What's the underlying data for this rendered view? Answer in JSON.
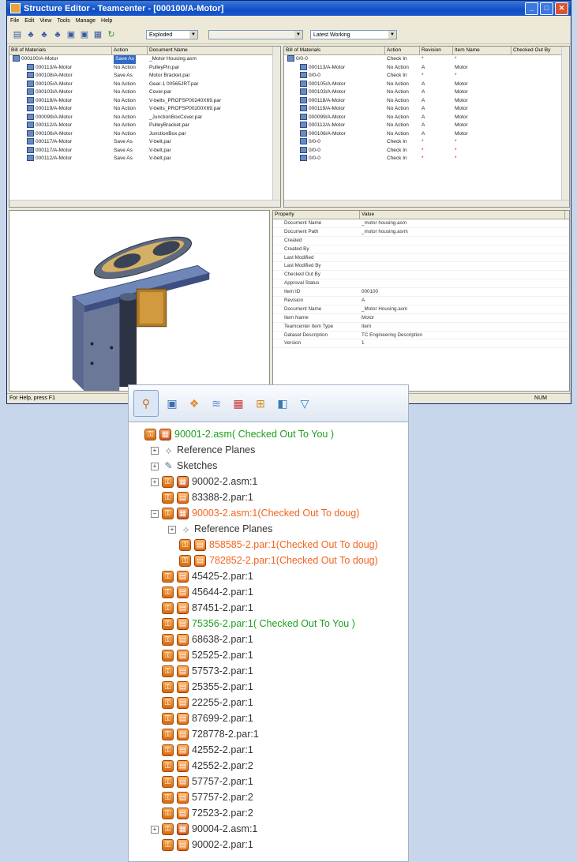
{
  "window": {
    "title": "Structure Editor - Teamcenter - [000100/A-Motor]",
    "menu": [
      "File",
      "Edit",
      "View",
      "Tools",
      "Manage",
      "Help"
    ],
    "toolbar": {
      "view_mode": "Exploded",
      "search_text": "",
      "revision_rule": "Latest Working"
    },
    "status_left": "For Help, press F1",
    "status_right": "NUM"
  },
  "left_bom": {
    "headers": [
      "Bill of Materials",
      "Action",
      "Document Name"
    ],
    "rows": [
      {
        "item": "000100/A-Motor",
        "action": "Save As",
        "doc": "_Motor Housing.asm"
      },
      {
        "item": "000113/A-Motor",
        "action": "No Action",
        "doc": "PulleyPin.par"
      },
      {
        "item": "000108/A-Motor",
        "action": "Save As",
        "doc": "Motor Bracket.par"
      },
      {
        "item": "000105/A-Motor",
        "action": "No Action",
        "doc": "Gear-1 00565JRT.par"
      },
      {
        "item": "000103/A-Motor",
        "action": "No Action",
        "doc": "Cover.par"
      },
      {
        "item": "000118/A-Motor",
        "action": "No Action",
        "doc": "V-belts_PROFSP00240X69.par"
      },
      {
        "item": "000119/A-Motor",
        "action": "No Action",
        "doc": "V-belts_PROFSP00200X69.par"
      },
      {
        "item": "000099/A-Motor",
        "action": "No Action",
        "doc": "_JunctionBoxCover.par"
      },
      {
        "item": "000112/A-Motor",
        "action": "No Action",
        "doc": "PulleyBracket.par"
      },
      {
        "item": "000106/A-Motor",
        "action": "No Action",
        "doc": "JunctionBox.par"
      },
      {
        "item": "000117/A-Motor",
        "action": "Save As",
        "doc": "V-belt.par"
      },
      {
        "item": "000117/A-Motor",
        "action": "Save As",
        "doc": "V-belt.par"
      },
      {
        "item": "000112/A-Motor",
        "action": "Save As",
        "doc": "V-belt.par"
      }
    ]
  },
  "right_bom": {
    "headers": [
      "Bill of Materials",
      "Action",
      "Revision",
      "Item Name",
      "Checked Out By"
    ],
    "rows": [
      {
        "item": "0/0-0",
        "action": "Check In",
        "rev": "*",
        "name": "*",
        "by": ""
      },
      {
        "item": "000113/A-Motor",
        "action": "No Action",
        "rev": "A",
        "name": "Motor",
        "by": ""
      },
      {
        "item": "0/0-0",
        "action": "Check In",
        "rev": "*",
        "name": "*",
        "by": ""
      },
      {
        "item": "000105/A-Motor",
        "action": "No Action",
        "rev": "A",
        "name": "Motor",
        "by": ""
      },
      {
        "item": "000103/A-Motor",
        "action": "No Action",
        "rev": "A",
        "name": "Motor",
        "by": ""
      },
      {
        "item": "000118/A-Motor",
        "action": "No Action",
        "rev": "A",
        "name": "Motor",
        "by": ""
      },
      {
        "item": "000119/A-Motor",
        "action": "No Action",
        "rev": "A",
        "name": "Motor",
        "by": ""
      },
      {
        "item": "000099/A-Motor",
        "action": "No Action",
        "rev": "A",
        "name": "Motor",
        "by": ""
      },
      {
        "item": "000112/A-Motor",
        "action": "No Action",
        "rev": "A",
        "name": "Motor",
        "by": ""
      },
      {
        "item": "000106/A-Motor",
        "action": "No Action",
        "rev": "A",
        "name": "Motor",
        "by": ""
      },
      {
        "item": "0/0-0",
        "action": "Check In",
        "rev": "*",
        "name": "*",
        "by": ""
      },
      {
        "item": "0/0-0",
        "action": "Check In",
        "rev": "*",
        "name": "*",
        "by": ""
      },
      {
        "item": "0/0-0",
        "action": "Check In",
        "rev": "*",
        "name": "*",
        "by": ""
      }
    ]
  },
  "properties": {
    "headers": [
      "Property",
      "Value"
    ],
    "rows": [
      {
        "k": "Document Name",
        "v": "_motor housing.asm"
      },
      {
        "k": "Document Path",
        "v": "_motor housing.asm\\"
      },
      {
        "k": "Created",
        "v": ""
      },
      {
        "k": "Created By",
        "v": ""
      },
      {
        "k": "Last Modified",
        "v": ""
      },
      {
        "k": "Last Modified By",
        "v": ""
      },
      {
        "k": "Checked Out By",
        "v": ""
      },
      {
        "k": "Approval Status",
        "v": ""
      },
      {
        "k": "Item ID",
        "v": "000100"
      },
      {
        "k": "Revision",
        "v": "A"
      },
      {
        "k": "Document Name",
        "v": "_Motor Housing.asm"
      },
      {
        "k": "Item Name",
        "v": "Motor"
      },
      {
        "k": "Teamcenter Item Type",
        "v": "Item"
      },
      {
        "k": "Dataset Description",
        "v": "TC Engineering Description"
      },
      {
        "k": "Version",
        "v": "1"
      }
    ]
  },
  "tree": {
    "tool_icons": [
      "pathfinder-icon",
      "parts-icon",
      "assemblies-icon",
      "layers-icon",
      "features-icon",
      "sensors-icon",
      "libraries-icon",
      "filter-icon"
    ],
    "items": [
      {
        "label": "90001-2.asm( Checked Out To You )",
        "kind": "asm",
        "status": "green",
        "indent": 0,
        "expander": ""
      },
      {
        "label": "Reference Planes",
        "kind": "ref",
        "status": "",
        "indent": 1,
        "expander": "+"
      },
      {
        "label": "Sketches",
        "kind": "sk",
        "status": "",
        "indent": 1,
        "expander": "+"
      },
      {
        "label": "90002-2.asm:1",
        "kind": "asm",
        "status": "",
        "indent": 1,
        "expander": "+"
      },
      {
        "label": "83388-2.par:1",
        "kind": "par",
        "status": "",
        "indent": 1,
        "expander": ""
      },
      {
        "label": "90003-2.asm:1(Checked Out To doug)",
        "kind": "asm",
        "status": "orange",
        "indent": 1,
        "expander": "-"
      },
      {
        "label": "Reference Planes",
        "kind": "ref",
        "status": "",
        "indent": 2,
        "expander": "+"
      },
      {
        "label": "858585-2.par:1(Checked Out To doug)",
        "kind": "par",
        "status": "orange",
        "indent": 2,
        "expander": ""
      },
      {
        "label": "782852-2.par:1(Checked Out To doug)",
        "kind": "par",
        "status": "orange",
        "indent": 2,
        "expander": ""
      },
      {
        "label": "45425-2.par:1",
        "kind": "par",
        "status": "",
        "indent": 1,
        "expander": ""
      },
      {
        "label": "45644-2.par:1",
        "kind": "par",
        "status": "",
        "indent": 1,
        "expander": ""
      },
      {
        "label": "87451-2.par:1",
        "kind": "par",
        "status": "",
        "indent": 1,
        "expander": ""
      },
      {
        "label": "75356-2.par:1( Checked Out To You )",
        "kind": "par",
        "status": "green",
        "indent": 1,
        "expander": ""
      },
      {
        "label": "68638-2.par:1",
        "kind": "par",
        "status": "",
        "indent": 1,
        "expander": ""
      },
      {
        "label": "52525-2.par:1",
        "kind": "par",
        "status": "",
        "indent": 1,
        "expander": ""
      },
      {
        "label": "57573-2.par:1",
        "kind": "par",
        "status": "",
        "indent": 1,
        "expander": ""
      },
      {
        "label": "25355-2.par:1",
        "kind": "par",
        "status": "",
        "indent": 1,
        "expander": ""
      },
      {
        "label": "22255-2.par:1",
        "kind": "par",
        "status": "",
        "indent": 1,
        "expander": ""
      },
      {
        "label": "87699-2.par:1",
        "kind": "par",
        "status": "",
        "indent": 1,
        "expander": ""
      },
      {
        "label": "728778-2.par:1",
        "kind": "par",
        "status": "",
        "indent": 1,
        "expander": ""
      },
      {
        "label": "42552-2.par:1",
        "kind": "par",
        "status": "",
        "indent": 1,
        "expander": ""
      },
      {
        "label": "42552-2.par:2",
        "kind": "par",
        "status": "",
        "indent": 1,
        "expander": ""
      },
      {
        "label": "57757-2.par:1",
        "kind": "par",
        "status": "",
        "indent": 1,
        "expander": ""
      },
      {
        "label": "57757-2.par:2",
        "kind": "par",
        "status": "",
        "indent": 1,
        "expander": ""
      },
      {
        "label": "72523-2.par:2",
        "kind": "par",
        "status": "",
        "indent": 1,
        "expander": ""
      },
      {
        "label": "90004-2.asm:1",
        "kind": "asm",
        "status": "",
        "indent": 1,
        "expander": "+"
      },
      {
        "label": "90002-2.par:1",
        "kind": "par",
        "status": "",
        "indent": 1,
        "expander": ""
      }
    ]
  }
}
